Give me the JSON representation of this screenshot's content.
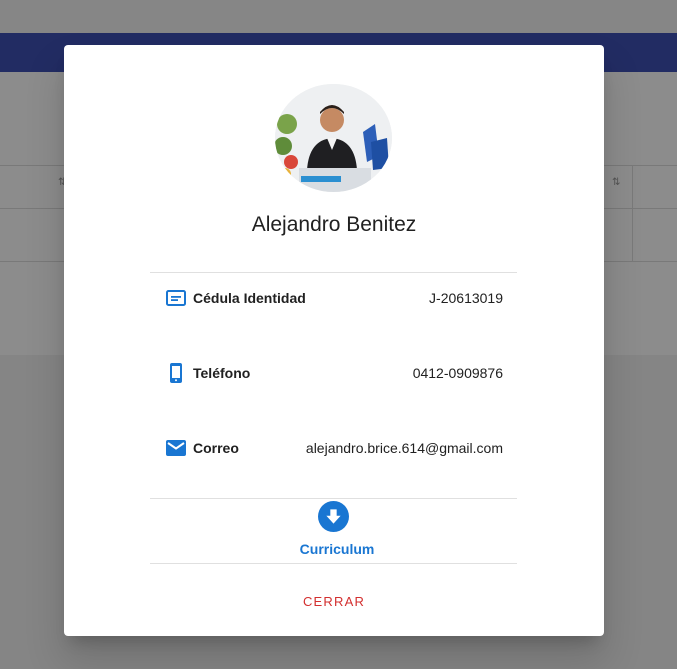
{
  "profile": {
    "name": "Alejandro Benitez",
    "photo_icon": "profile-photo"
  },
  "details": [
    {
      "icon": "id-card-icon",
      "label": "Cédula Identidad",
      "value": "J-20613019"
    },
    {
      "icon": "phone-icon",
      "label": "Teléfono",
      "value": "0412-0909876"
    },
    {
      "icon": "email-icon",
      "label": "Correo",
      "value": "alejandro.brice.614@gmail.com"
    }
  ],
  "curriculum": {
    "icon": "download-icon",
    "label": "Curriculum"
  },
  "actions": {
    "close_label": "CERRAR"
  },
  "colors": {
    "accent": "#1976d2",
    "danger": "#d32f2f",
    "appbar": "#3f51b5"
  }
}
